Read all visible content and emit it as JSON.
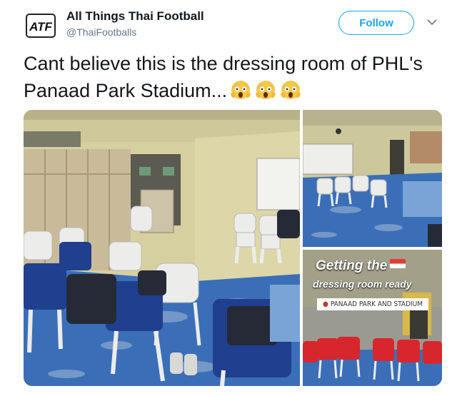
{
  "header": {
    "logo_text": "ATF",
    "display_name": "All Things Thai Football",
    "handle": "@ThaiFootballs",
    "follow_label": "Follow"
  },
  "tweet": {
    "text": "Cant believe this is the dressing room of PHL's Panaad Park Stadium...",
    "emoji": [
      "face-screaming-in-fear",
      "face-screaming-in-fear",
      "face-screaming-in-fear"
    ]
  },
  "media": {
    "photo3_title": "Getting the",
    "photo3_subtitle": "dressing room ready",
    "photo3_location": "PANAAD PARK AND STADIUM"
  },
  "colors": {
    "accent": "#1da1f2",
    "floor_blue": "#3a6fb8",
    "chair_red": "#d8262e"
  }
}
